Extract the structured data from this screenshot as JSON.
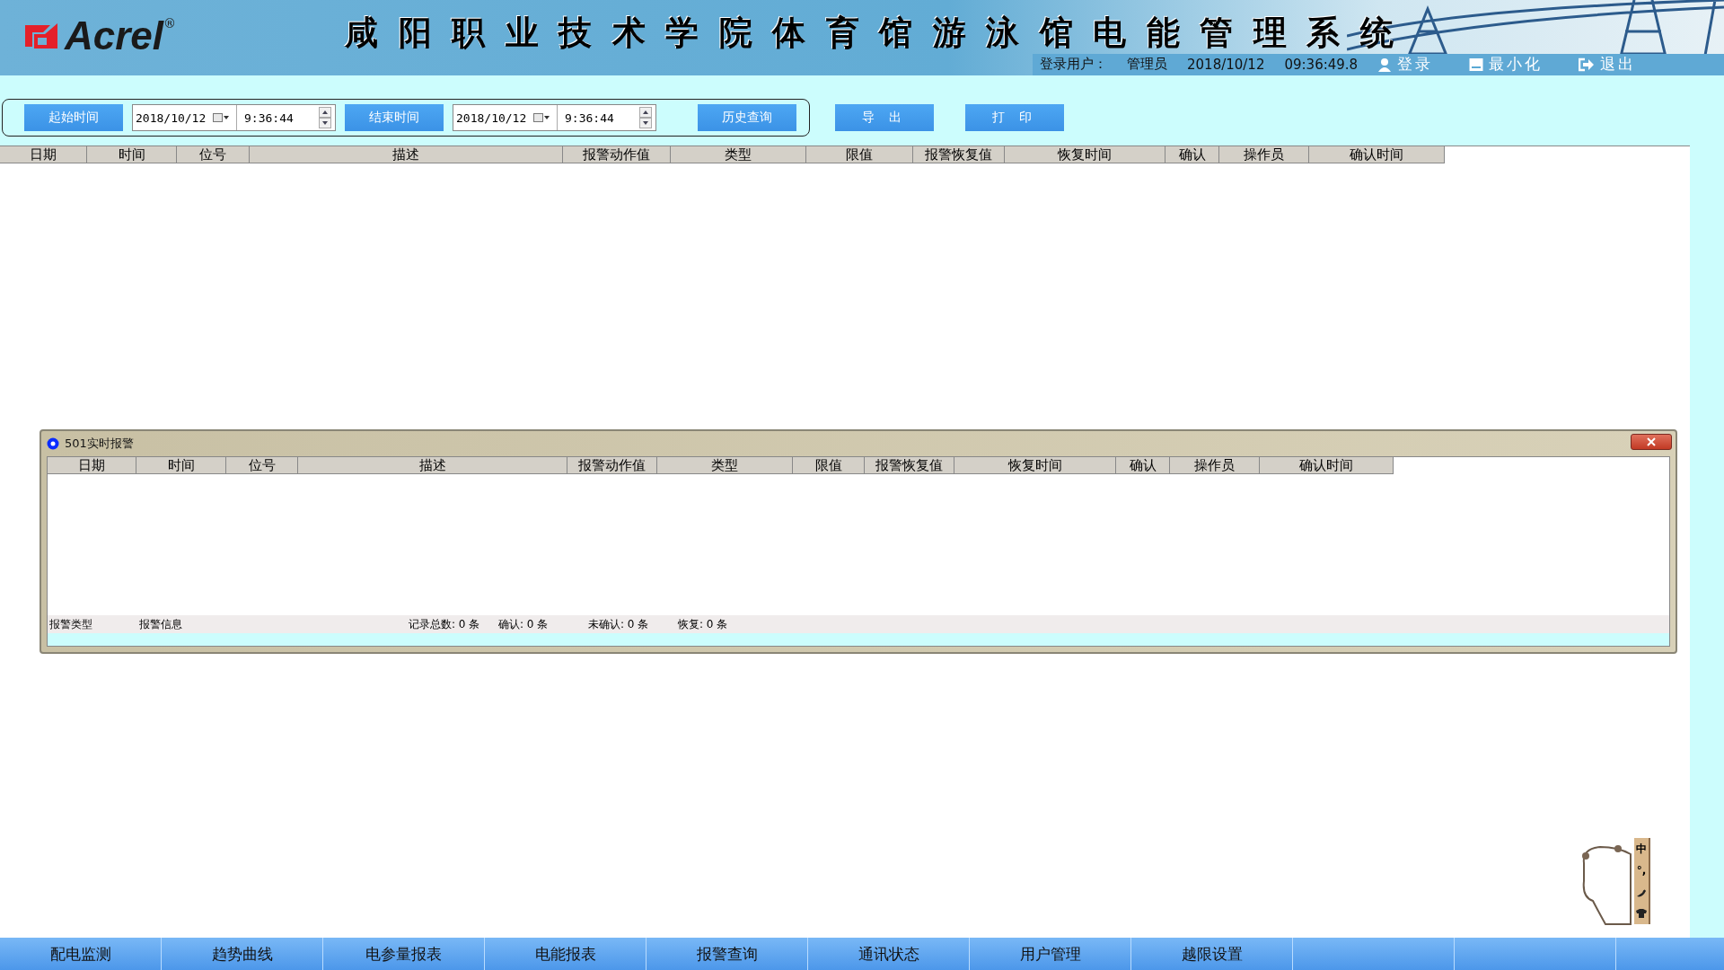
{
  "header": {
    "brand": "Acrel",
    "registered": "®",
    "title": "咸阳职业技术学院体育馆游泳馆电能管理系统",
    "user_label": "登录用户：",
    "user": "管理员",
    "date": "2018/10/12",
    "time": "09:36:49.8",
    "actions": [
      {
        "kind": "login",
        "label": "登录"
      },
      {
        "kind": "minimize",
        "label": "最小化"
      },
      {
        "kind": "exit",
        "label": "退出"
      }
    ]
  },
  "query_bar": {
    "start_button": "起始时间",
    "start_date": "2018/10/12",
    "start_time": "9:36:44",
    "end_button": "结束时间",
    "end_date": "2018/10/12",
    "end_time": "9:36:44",
    "history_button": "历史查询"
  },
  "tools": [
    "导 出",
    "打 印"
  ],
  "table": {
    "columns": [
      "日期",
      "时间",
      "位号",
      "描述",
      "报警动作值",
      "类型",
      "限值",
      "报警恢复值",
      "恢复时间",
      "确认",
      "操作员",
      "确认时间"
    ]
  },
  "alarm_window": {
    "title": "501实时报警",
    "columns": [
      "日期",
      "时间",
      "位号",
      "描述",
      "报警动作值",
      "类型",
      "限值",
      "报警恢复值",
      "恢复时间",
      "确认",
      "操作员",
      "确认时间"
    ],
    "status": [
      "报警类型",
      "报警信息",
      "记录总数: 0 条",
      "确认: 0 条",
      "未确认: 0 条",
      "恢复: 0 条"
    ]
  },
  "ime": {
    "mode": "中",
    "punctuation": "°,"
  },
  "nav": [
    {
      "label": "配电监测"
    },
    {
      "label": "趋势曲线"
    },
    {
      "label": "电参量报表"
    },
    {
      "label": "电能报表"
    },
    {
      "label": "报警查询"
    },
    {
      "label": "通讯状态"
    },
    {
      "label": "用户管理"
    },
    {
      "label": "越限设置"
    }
  ]
}
